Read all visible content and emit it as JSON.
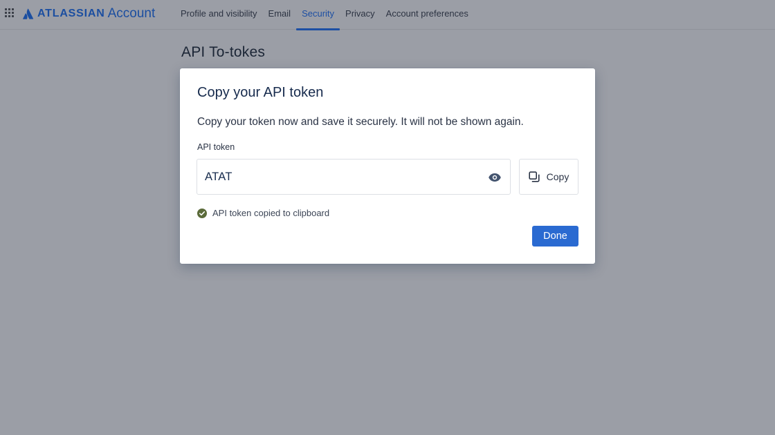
{
  "header": {
    "app_switcher_icon": "grid-icon",
    "brand": "ATLASSIAN",
    "product": "Account",
    "nav": [
      {
        "label": "Profile and visibility",
        "active": false
      },
      {
        "label": "Email",
        "active": false
      },
      {
        "label": "Security",
        "active": true
      },
      {
        "label": "Privacy",
        "active": false
      },
      {
        "label": "Account preferences",
        "active": false
      }
    ]
  },
  "page": {
    "title": "API To-tokes"
  },
  "modal": {
    "title": "Copy your API token",
    "description": "Copy your token now and save it securely. It will not be shown again.",
    "field_label": "API token",
    "token_value": "ATAT",
    "reveal_icon": "eye-icon",
    "copy_icon": "copy-icon",
    "copy_label": "Copy",
    "status_icon": "check-circle-icon",
    "status_text": "API token copied to clipboard",
    "done_label": "Done"
  },
  "colors": {
    "brand": "#1b4ea0",
    "primary_button": "#2a6ad1",
    "active_tab": "#1d4fa3",
    "success": "#5b6b3a",
    "overlay_background": "#9b9ea6"
  }
}
